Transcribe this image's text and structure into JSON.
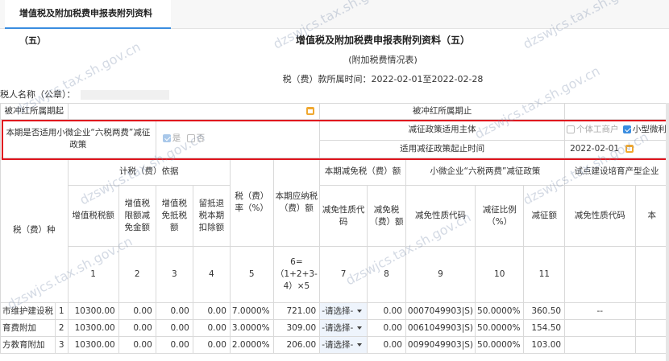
{
  "tab": {
    "label": "增值税及附加税费申报表附列资料（五）"
  },
  "header": {
    "title": "增值税及附加税费申报表附列资料（五）",
    "subtitle": "(附加税费情况表)",
    "period": "税（费）款所属时间：2022-02-01至2022-02-28"
  },
  "taxpayer": {
    "label": "税人名称（公章）："
  },
  "row_offset": {
    "start_label": "被冲红所属期起",
    "end_label": "被冲红所属期止"
  },
  "policy": {
    "question": "本期是否适用小微企业“六税两费”减征政策",
    "yes": "是",
    "no": "否",
    "subject_label": "减征政策适用主体",
    "opt_individual": "个体工商户",
    "opt_small": "小型微利",
    "time_label": "适用减征政策起止时间",
    "start_date": "2022-02-01"
  },
  "columns": {
    "tax_type": "税（费）种",
    "basis_group": "计税（费）依据",
    "vat_amount": "增值税税额",
    "vat_limit_reduction": "增值税限额减免金额",
    "vat_exempt_offset": "增值税免抵税额",
    "retained_deduct": "留抵退税本期扣除额",
    "rate": "税（费）率（%）",
    "payable": "本期应纳税（费）额",
    "reduction_group": "本期减免税（费）额",
    "reduction_code": "减免性质代码",
    "reduction_amount": "减免税（费）额",
    "small_group": "小微企业“六税两费”减征政策",
    "small_code": "减免性质代码",
    "small_ratio": "减征比例（%）",
    "small_amount": "减征额",
    "pilot_group": "试点建设培育产型企业",
    "pilot_code": "减免性质代码",
    "pilot_extra": "本"
  },
  "col_numbers": [
    "1",
    "2",
    "3",
    "4",
    "5",
    "6=（1+2+3-4）×5",
    "7",
    "8",
    "9",
    "10",
    "11"
  ],
  "rows": [
    {
      "name": "市维护建设税",
      "idx": "1",
      "vat": "10300.00",
      "limit": "0.00",
      "exempt": "0.00",
      "retain": "0.00",
      "rate": "7.0000%",
      "payable": "721.00",
      "select": "-请选择-",
      "red_amt": "0.00",
      "small_code": "0007049903|S)",
      "ratio": "50.0000%",
      "small_amt": "360.50",
      "pilot": "--"
    },
    {
      "name": "育费附加",
      "idx": "2",
      "vat": "10300.00",
      "limit": "0.00",
      "exempt": "0.00",
      "retain": "0.00",
      "rate": "3.0000%",
      "payable": "309.00",
      "select": "-请选择-",
      "red_amt": "0.00",
      "small_code": "0061049903|S)",
      "ratio": "50.0000%",
      "small_amt": "154.50",
      "pilot": ""
    },
    {
      "name": "方教育附加",
      "idx": "3",
      "vat": "10300.00",
      "limit": "0.00",
      "exempt": "0.00",
      "retain": "0.00",
      "rate": "2.0000%",
      "payable": "206.00",
      "select": "-请选择-",
      "red_amt": "0.00",
      "small_code": "0099049903|S)",
      "ratio": "50.0000%",
      "small_amt": "103.00",
      "pilot": ""
    }
  ],
  "watermark": "dzswjcs.tax.sh.gov.cn"
}
